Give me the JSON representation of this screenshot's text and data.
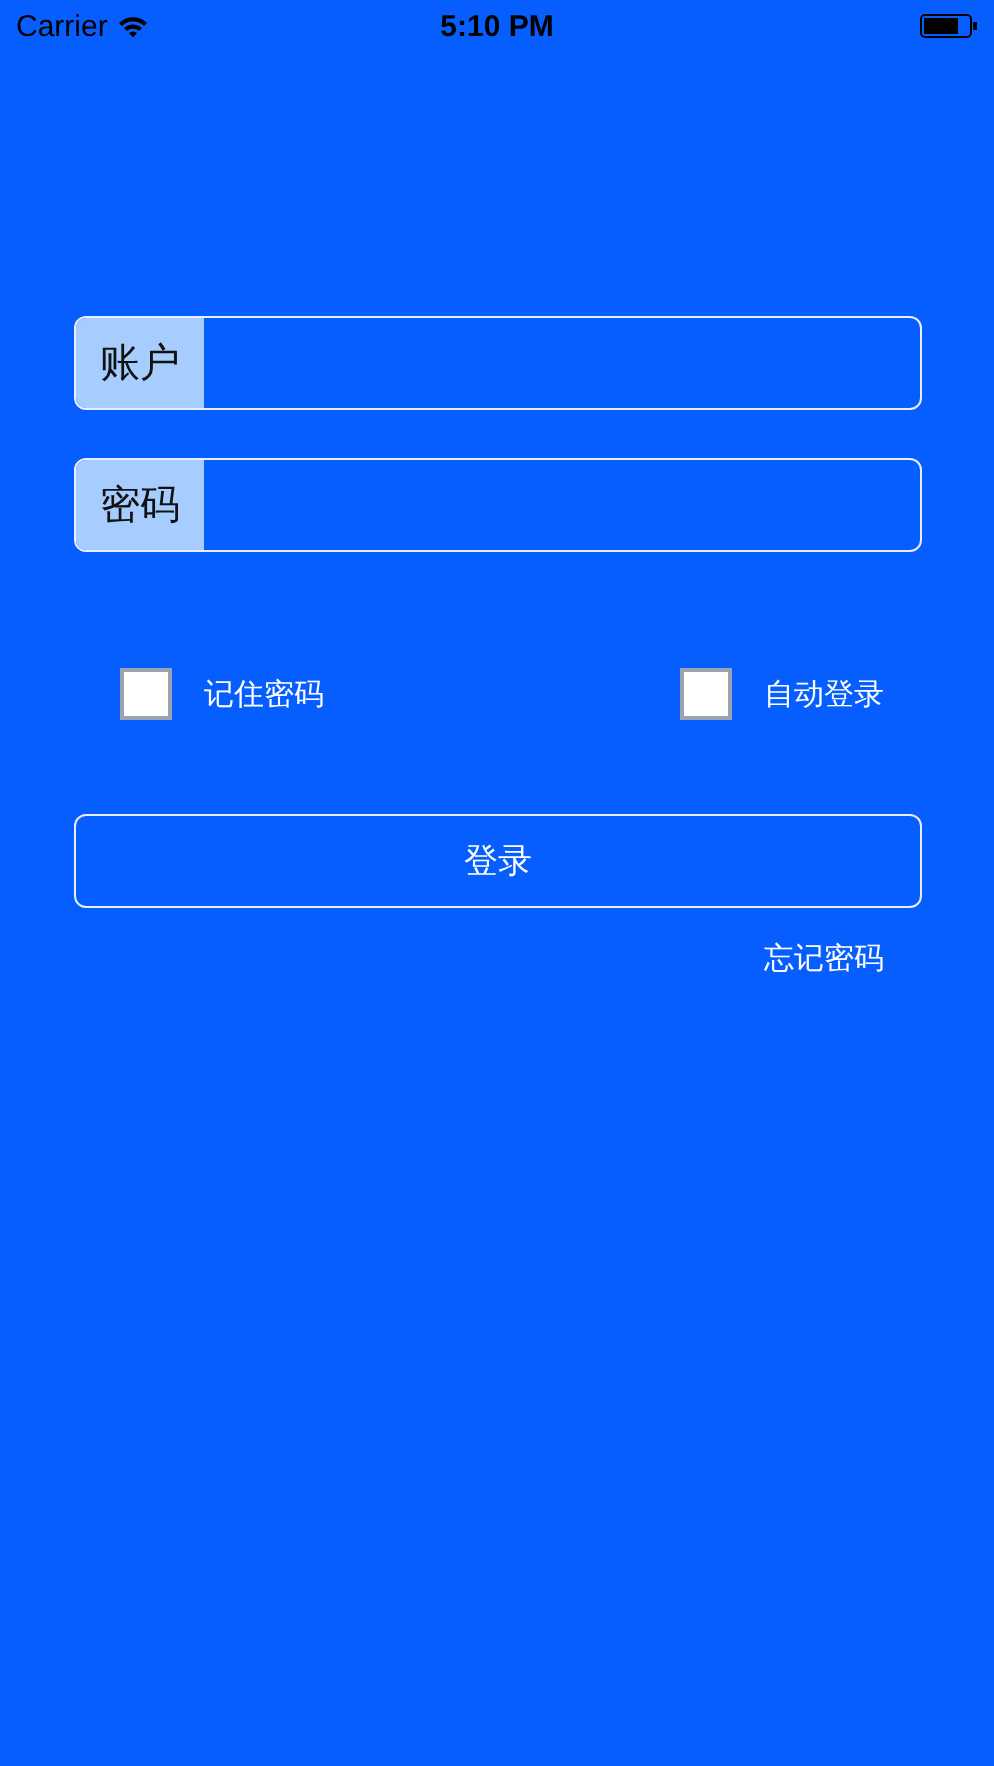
{
  "status_bar": {
    "carrier": "Carrier",
    "time": "5:10 PM"
  },
  "fields": [
    {
      "label": "账户"
    },
    {
      "label": "密码"
    }
  ],
  "options": [
    {
      "label": "记住密码",
      "checked": false
    },
    {
      "label": "自动登录",
      "checked": false
    }
  ],
  "login_button": "登录",
  "forgot_link": "忘记密码"
}
